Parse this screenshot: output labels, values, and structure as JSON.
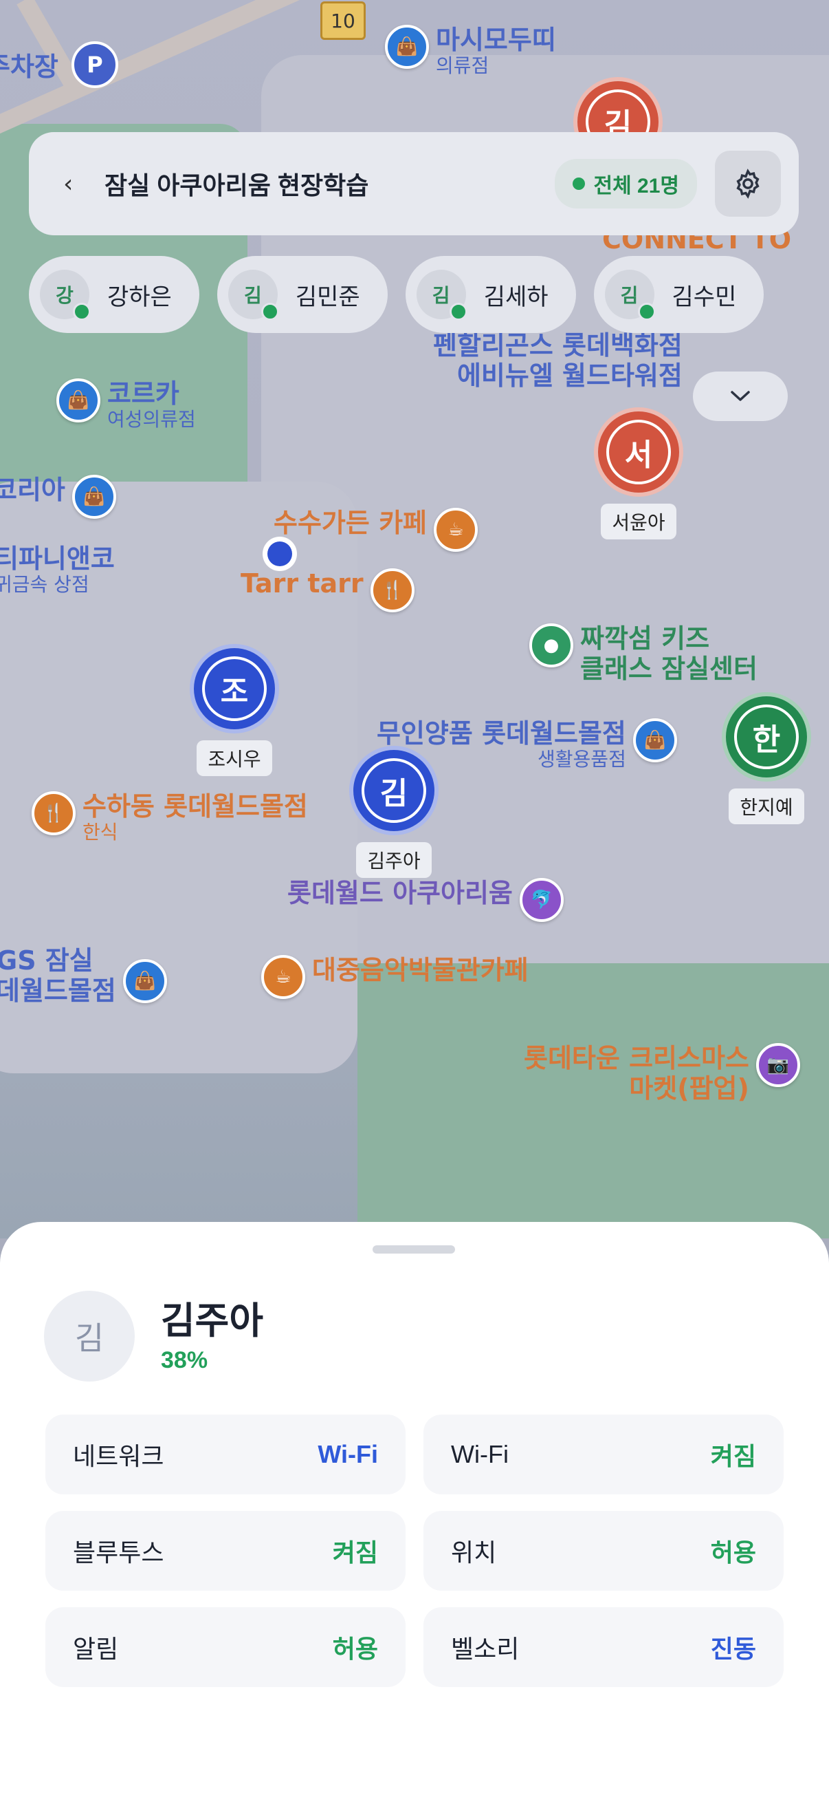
{
  "colors": {
    "accent_green": "#22a05a",
    "accent_blue": "#2f5ad9"
  },
  "header": {
    "back_icon": "chevron-left-icon",
    "title": "잠실 아쿠아리움 현장학습",
    "count": "전체 21명",
    "settings_icon": "gear-icon"
  },
  "chips": [
    {
      "initial": "강",
      "name": "강하은"
    },
    {
      "initial": "김",
      "name": "김민준"
    },
    {
      "initial": "김",
      "name": "김세하"
    },
    {
      "initial": "김",
      "name": "김수민"
    }
  ],
  "map": {
    "pois": [
      {
        "l1": "마시모두띠",
        "l2": "의류점"
      },
      {
        "l1": "코르카",
        "l2": "여성의류점"
      },
      {
        "l1": "코리아",
        "l2": ""
      },
      {
        "l1": "수수가든 카페",
        "l2": ""
      },
      {
        "l1": "Tarr tarr",
        "l2": ""
      },
      {
        "l1": "짜깍섬 키즈",
        "l2": "클래스 잠실센터"
      },
      {
        "l1": "무인양품 롯데월드몰점",
        "l2": "생활용품점"
      },
      {
        "l1": "수하동 롯데월드몰점",
        "l2": "한식"
      },
      {
        "l1": "롯데월드 아쿠아리움",
        "l2": ""
      },
      {
        "l1": "대중음악박물관카페",
        "l2": ""
      },
      {
        "l1": "롯데타운 크리스마스",
        "l2": "마켓(팝업)"
      },
      {
        "l1": "펜할리곤스 롯데백화점",
        "l2": "에비뉴엘 월드타워점"
      },
      {
        "l1": "GS 잠실",
        "l2": "데월드몰점"
      },
      {
        "l1": "티파니앤코",
        "l2": "귀금속 상점"
      },
      {
        "l1": "CONNECT TO",
        "l2": ""
      }
    ],
    "road_number": "10",
    "parking": "P",
    "parking_label": "주차장",
    "markers": [
      {
        "initial": "조",
        "name": "조시우"
      },
      {
        "initial": "김",
        "name": "김주아"
      },
      {
        "initial": "서",
        "name": "서윤아"
      },
      {
        "initial": "한",
        "name": "한지예"
      },
      {
        "initial": "김",
        "name": ""
      }
    ]
  },
  "sheet": {
    "avatar_initial": "김",
    "name": "김주아",
    "percent": "38%",
    "rows": [
      {
        "key": "네트워크",
        "value": "Wi-Fi"
      },
      {
        "key": "Wi-Fi",
        "value": "켜짐"
      },
      {
        "key": "블루투스",
        "value": "켜짐"
      },
      {
        "key": "위치",
        "value": "허용"
      },
      {
        "key": "알림",
        "value": "허용"
      },
      {
        "key": "벨소리",
        "value": "진동"
      }
    ]
  }
}
